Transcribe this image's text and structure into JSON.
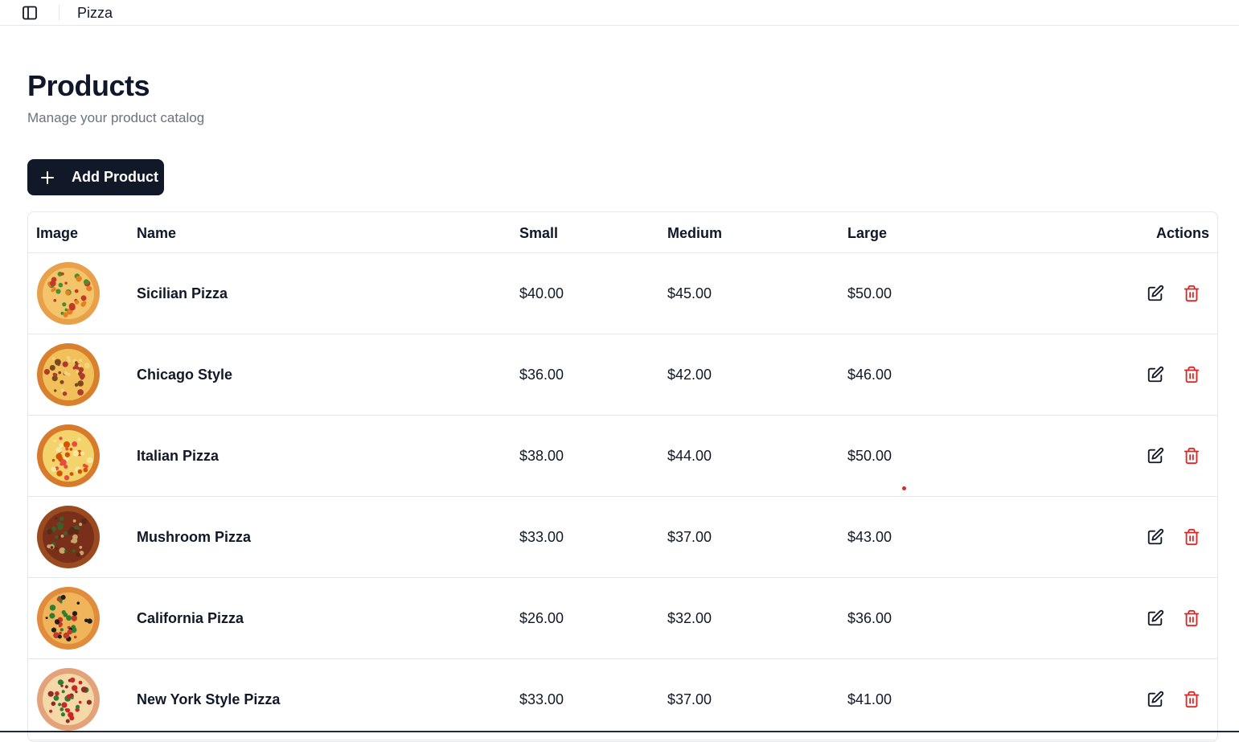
{
  "header": {
    "app_title": "Pizza",
    "sidebar_toggle_icon": "panel-left-icon"
  },
  "page": {
    "title": "Products",
    "subtitle": "Manage your product catalog",
    "add_button_label": "Add Product",
    "add_button_icon": "plus-icon"
  },
  "colors": {
    "primary": "#111827",
    "danger": "#dc2626",
    "muted_text": "#6b7280",
    "border": "#e5e7eb"
  },
  "table": {
    "columns": {
      "image": "Image",
      "name": "Name",
      "small": "Small",
      "medium": "Medium",
      "large": "Large",
      "actions": "Actions"
    },
    "rows": [
      {
        "name": "Sicilian Pizza",
        "small": "$40.00",
        "medium": "$45.00",
        "large": "$50.00",
        "image_icon": "pizza-image"
      },
      {
        "name": "Chicago Style",
        "small": "$36.00",
        "medium": "$42.00",
        "large": "$46.00",
        "image_icon": "pizza-image"
      },
      {
        "name": "Italian Pizza",
        "small": "$38.00",
        "medium": "$44.00",
        "large": "$50.00",
        "image_icon": "pizza-image"
      },
      {
        "name": "Mushroom Pizza",
        "small": "$33.00",
        "medium": "$37.00",
        "large": "$43.00",
        "image_icon": "pizza-image"
      },
      {
        "name": "California Pizza",
        "small": "$26.00",
        "medium": "$32.00",
        "large": "$36.00",
        "image_icon": "pizza-image"
      },
      {
        "name": "New York Style Pizza",
        "small": "$33.00",
        "medium": "$37.00",
        "large": "$41.00",
        "image_icon": "pizza-image"
      }
    ],
    "row_actions": [
      "edit-icon",
      "trash-icon"
    ]
  }
}
